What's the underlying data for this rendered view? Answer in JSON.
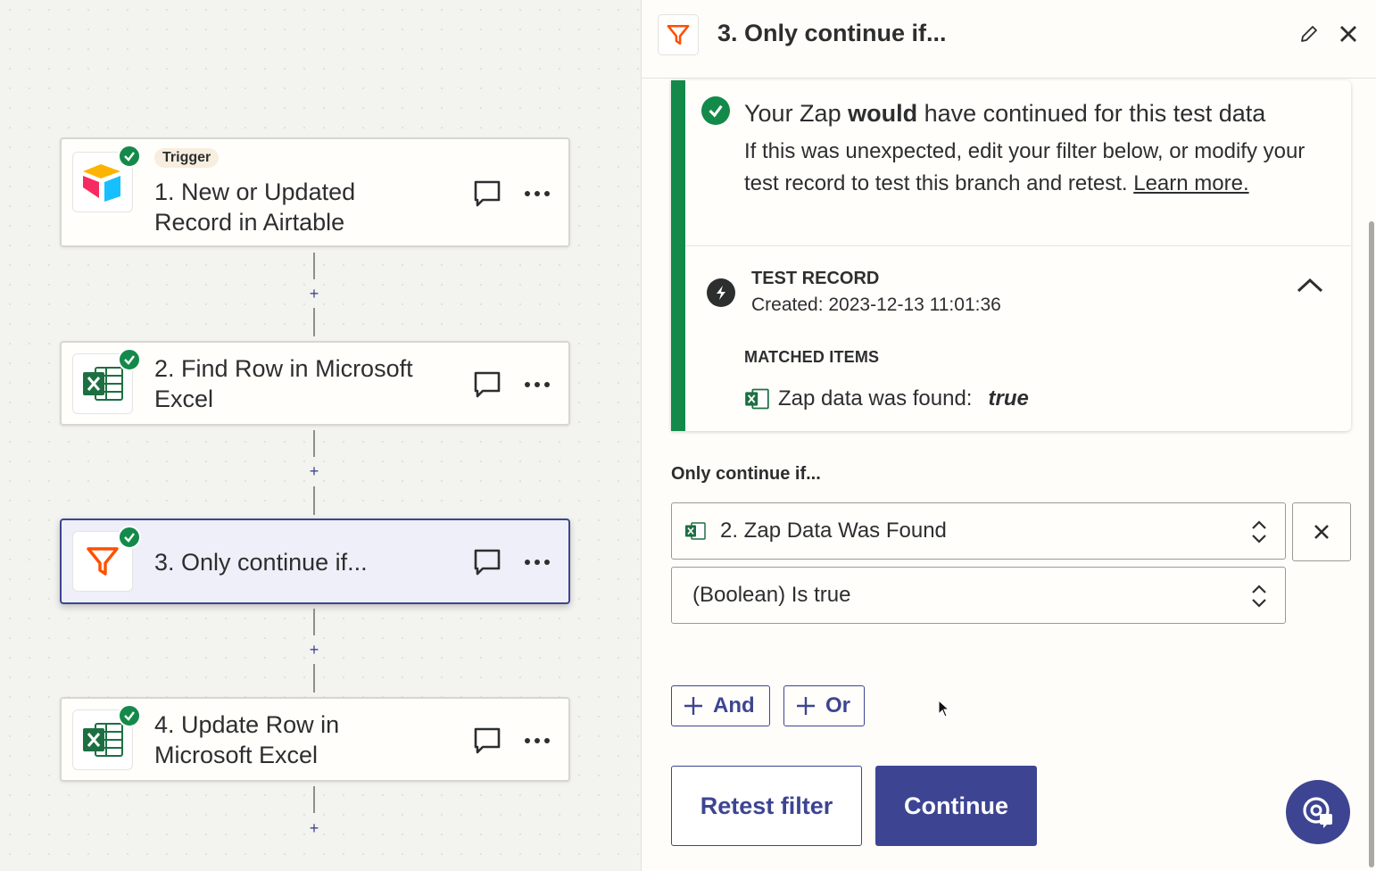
{
  "canvas": {
    "steps": [
      {
        "badge": "Trigger",
        "title_line1": "1. New or Updated",
        "title_line2": "Record in Airtable",
        "app_icon": "airtable-icon"
      },
      {
        "title_line1": "2. Find Row in Microsoft",
        "title_line2": "Excel",
        "app_icon": "excel-icon"
      },
      {
        "title_line1": "3. Only continue if...",
        "app_icon": "filter-icon",
        "selected": true
      },
      {
        "title_line1": "4. Update Row in",
        "title_line2": "Microsoft Excel",
        "app_icon": "excel-icon"
      }
    ],
    "plus_label": "+"
  },
  "panel": {
    "title": "3. Only continue if...",
    "result": {
      "heading_pre": "Your Zap ",
      "heading_bold": "would",
      "heading_post": " have continued for this test data",
      "body": "If this was unexpected, edit your filter below, or modify your test record to test this branch and retest. ",
      "link": "Learn more.",
      "test_record_label": "TEST RECORD",
      "test_record_created": "Created: 2023-12-13 11:01:36",
      "matched_label": "MATCHED ITEMS",
      "matched_key": "Zap data was found:",
      "matched_value": "true"
    },
    "filter": {
      "label": "Only continue if...",
      "field_value": "2. Zap Data Was Found",
      "condition_value": "(Boolean) Is true",
      "and_label": "And",
      "or_label": "Or"
    },
    "retest_label": "Retest filter",
    "continue_label": "Continue"
  },
  "colors": {
    "brand": "#3d4592",
    "success": "#138a4a",
    "zapier_orange": "#ff4f00",
    "excel_green": "#1d6f42"
  }
}
